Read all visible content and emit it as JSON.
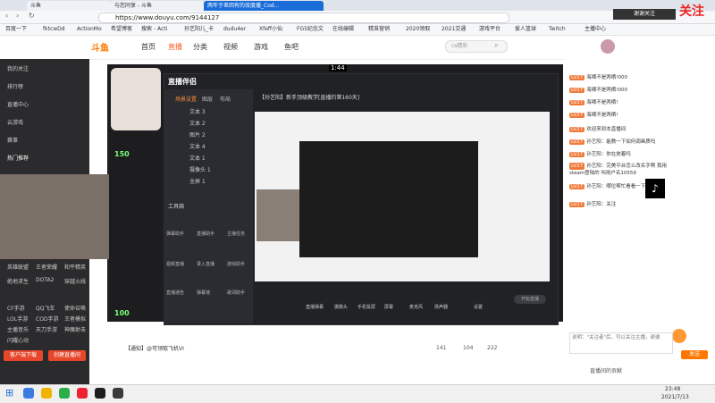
{
  "browser": {
    "tabs": [
      "斗鱼",
      "与您同享 - 斗鱼",
      "两年于差回有的效度播_Cod..."
    ],
    "url": "https://www.douyu.com/9144127",
    "bookmarks": [
      "百度一下",
      "fktcwDd",
      "ActionMo",
      "希望博客",
      "搜索 - Acti",
      "孙艺阳儿_卡",
      "dudu4er",
      "Xfeff小仙",
      "FG5纪念文",
      "在线编辑",
      "精准营销",
      "2020领取",
      "2021交通",
      "游戏平台",
      "爱人篮球",
      "Twitch",
      "主播中心"
    ],
    "top_right_overlay": "谢谢关注",
    "follow_label": "关注"
  },
  "site": {
    "logo": "斗鱼",
    "nav": [
      "首页",
      "直播",
      "分类",
      "视频",
      "游戏",
      "鱼吧"
    ],
    "search_placeholder": "cs精彩"
  },
  "sidebar": {
    "items": [
      "我的关注",
      "排行榜",
      "直播中心",
      "云游戏",
      "赛事",
      "推荐",
      "我的道具"
    ],
    "section_label": "热门推荐",
    "games": [
      "英雄联盟",
      "王者荣耀",
      "和平精英",
      "绝地求生",
      "DOTA2",
      "穿越火线",
      "CF手游",
      "QQ飞车",
      "使命召唤",
      "LOL手游",
      "COD手游",
      "王者模拟",
      "主播音乐",
      "天刀手游",
      "神魔射击",
      "闪耀心动"
    ],
    "footer_left": "客户端下载",
    "footer_right": "创建直播间"
  },
  "player": {
    "tool_title": "直播伴侣",
    "tool_tabs": [
      "场景设置",
      "图层",
      "布局"
    ],
    "scene_items": [
      "文本 3",
      "文本 2",
      "图片 2",
      "文本 4",
      "文本 1",
      "摄像头 1",
      "全屏 1"
    ],
    "toolbox_label": "工具箱",
    "tools": [
      "弹幕助手",
      "直播助手",
      "主播任务",
      "视频直播",
      "录入直播",
      "游戏助手",
      "直播通告",
      "弹幕墙",
      "歌词助手"
    ],
    "stream_title": "【孙艺阳】新手顶级教学[直播约第160天]",
    "bottom_bar": [
      "直播弹幕",
      "摄像头",
      "手机投屏",
      "屏幕",
      "麦克风",
      "扬声器",
      "设置"
    ],
    "start_btn": "开始直播",
    "timer": "1:44",
    "gift_count": "150",
    "hot_count": "100"
  },
  "below_player": {
    "notice": "【通知】@可领取飞机VI",
    "stats": [
      "141",
      "104",
      "222"
    ]
  },
  "chat": {
    "header": "谢谢关注",
    "entries": [
      {
        "lvl": "LV27",
        "text": "海啸不是两栖!000"
      },
      {
        "lvl": "LV27",
        "text": "海啸不是两栖!000"
      },
      {
        "lvl": "LV27",
        "text": "海啸不是两栖!"
      },
      {
        "lvl": "LV27",
        "text": "海啸不是两栖!"
      },
      {
        "lvl": "LV27",
        "text": "欢迎来到本直播间"
      },
      {
        "lvl": "LV27",
        "text": "孙艺阳：能教一下如何调画质吗"
      },
      {
        "lvl": "LV27",
        "text": "孙艺阳：你在放着吗"
      },
      {
        "lvl": "LV27",
        "text": "孙艺阳：完美平台怎么改名字啊 我用steam登陆的 叫用户名10559"
      },
      {
        "lvl": "LV27",
        "text": "孙艺阳：哪位帮忙看看一下"
      },
      {
        "lvl": "LV27",
        "text": "孙艺阳：关注"
      }
    ],
    "input_tip": "说明：\"关注者\"后，可以关注主播，谢谢",
    "send_btn": "发送",
    "rank_label": "直播间的贡献"
  },
  "taskbar": {
    "time": "23:48",
    "date": "2021/7/13"
  }
}
